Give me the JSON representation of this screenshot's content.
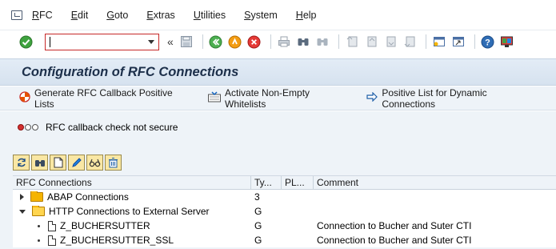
{
  "menu": {
    "items": [
      {
        "label": "RFC",
        "underline": "R",
        "rest": "FC"
      },
      {
        "label": "Edit",
        "underline": "E",
        "rest": "dit"
      },
      {
        "label": "Goto",
        "underline": "G",
        "rest": "oto"
      },
      {
        "label": "Extras",
        "underline": "E",
        "rest": "xtras"
      },
      {
        "label": "Utilities",
        "underline": "U",
        "rest": "tilities"
      },
      {
        "label": "System",
        "underline": "S",
        "rest": "ystem"
      },
      {
        "label": "Help",
        "underline": "H",
        "rest": "elp"
      }
    ]
  },
  "toolbar": {
    "command_value": "",
    "double_angle": "«"
  },
  "title": "Configuration of RFC Connections",
  "app_toolbar": {
    "btn1": "Generate RFC Callback Positive Lists",
    "btn2": "Activate Non-Empty Whitelists",
    "btn3": "Positive List for Dynamic Connections"
  },
  "status": {
    "text": "RFC callback check not secure"
  },
  "tree": {
    "headers": [
      "RFC Connections",
      "Ty...",
      "PL...",
      "Comment"
    ],
    "rows": [
      {
        "label": "ABAP Connections",
        "type": "3",
        "pl": "",
        "comment": ""
      },
      {
        "label": "HTTP Connections to External Server",
        "type": "G",
        "pl": "",
        "comment": ""
      },
      {
        "label": "Z_BUCHERSUTTER",
        "type": "G",
        "pl": "",
        "comment": "Connection to Bucher and Suter CTI"
      },
      {
        "label": "Z_BUCHERSUTTER_SSL",
        "type": "G",
        "pl": "",
        "comment": "Connection to Bucher and Suter CTI"
      }
    ]
  },
  "colors": {
    "title_bg": "#dbe5f1",
    "app_bg": "#eef3f8",
    "accent_red": "#c62828",
    "folder": "#f5b400"
  }
}
